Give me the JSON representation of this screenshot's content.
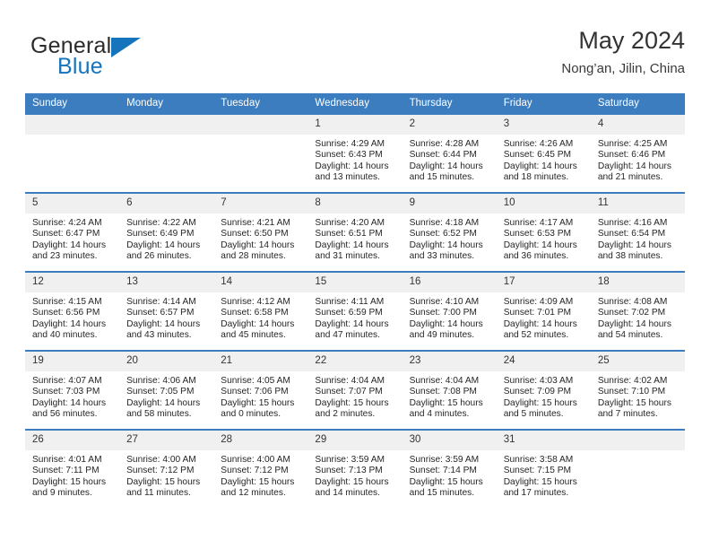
{
  "brand": {
    "line1": "General",
    "line2": "Blue",
    "flag_icon": "blue-triangle-flag",
    "accent_color": "#1574bb"
  },
  "header": {
    "title": "May 2024",
    "subtitle": "Nong’an, Jilin, China"
  },
  "theme": {
    "header_row_bg": "#3b7dbf",
    "header_row_text": "#ffffff",
    "daynum_bg": "#f0f0f0",
    "cell_border": "#3b7dbf"
  },
  "columns": [
    "Sunday",
    "Monday",
    "Tuesday",
    "Wednesday",
    "Thursday",
    "Friday",
    "Saturday"
  ],
  "labels": {
    "sunrise_prefix": "Sunrise:",
    "sunset_prefix": "Sunset:",
    "daylight_prefix": "Daylight:"
  },
  "weeks": [
    [
      {
        "day": "",
        "sunrise": "",
        "sunset": "",
        "daylight_a": "",
        "daylight_b": ""
      },
      {
        "day": "",
        "sunrise": "",
        "sunset": "",
        "daylight_a": "",
        "daylight_b": ""
      },
      {
        "day": "",
        "sunrise": "",
        "sunset": "",
        "daylight_a": "",
        "daylight_b": ""
      },
      {
        "day": "1",
        "sunrise": "Sunrise: 4:29 AM",
        "sunset": "Sunset: 6:43 PM",
        "daylight_a": "Daylight: 14 hours",
        "daylight_b": "and 13 minutes."
      },
      {
        "day": "2",
        "sunrise": "Sunrise: 4:28 AM",
        "sunset": "Sunset: 6:44 PM",
        "daylight_a": "Daylight: 14 hours",
        "daylight_b": "and 15 minutes."
      },
      {
        "day": "3",
        "sunrise": "Sunrise: 4:26 AM",
        "sunset": "Sunset: 6:45 PM",
        "daylight_a": "Daylight: 14 hours",
        "daylight_b": "and 18 minutes."
      },
      {
        "day": "4",
        "sunrise": "Sunrise: 4:25 AM",
        "sunset": "Sunset: 6:46 PM",
        "daylight_a": "Daylight: 14 hours",
        "daylight_b": "and 21 minutes."
      }
    ],
    [
      {
        "day": "5",
        "sunrise": "Sunrise: 4:24 AM",
        "sunset": "Sunset: 6:47 PM",
        "daylight_a": "Daylight: 14 hours",
        "daylight_b": "and 23 minutes."
      },
      {
        "day": "6",
        "sunrise": "Sunrise: 4:22 AM",
        "sunset": "Sunset: 6:49 PM",
        "daylight_a": "Daylight: 14 hours",
        "daylight_b": "and 26 minutes."
      },
      {
        "day": "7",
        "sunrise": "Sunrise: 4:21 AM",
        "sunset": "Sunset: 6:50 PM",
        "daylight_a": "Daylight: 14 hours",
        "daylight_b": "and 28 minutes."
      },
      {
        "day": "8",
        "sunrise": "Sunrise: 4:20 AM",
        "sunset": "Sunset: 6:51 PM",
        "daylight_a": "Daylight: 14 hours",
        "daylight_b": "and 31 minutes."
      },
      {
        "day": "9",
        "sunrise": "Sunrise: 4:18 AM",
        "sunset": "Sunset: 6:52 PM",
        "daylight_a": "Daylight: 14 hours",
        "daylight_b": "and 33 minutes."
      },
      {
        "day": "10",
        "sunrise": "Sunrise: 4:17 AM",
        "sunset": "Sunset: 6:53 PM",
        "daylight_a": "Daylight: 14 hours",
        "daylight_b": "and 36 minutes."
      },
      {
        "day": "11",
        "sunrise": "Sunrise: 4:16 AM",
        "sunset": "Sunset: 6:54 PM",
        "daylight_a": "Daylight: 14 hours",
        "daylight_b": "and 38 minutes."
      }
    ],
    [
      {
        "day": "12",
        "sunrise": "Sunrise: 4:15 AM",
        "sunset": "Sunset: 6:56 PM",
        "daylight_a": "Daylight: 14 hours",
        "daylight_b": "and 40 minutes."
      },
      {
        "day": "13",
        "sunrise": "Sunrise: 4:14 AM",
        "sunset": "Sunset: 6:57 PM",
        "daylight_a": "Daylight: 14 hours",
        "daylight_b": "and 43 minutes."
      },
      {
        "day": "14",
        "sunrise": "Sunrise: 4:12 AM",
        "sunset": "Sunset: 6:58 PM",
        "daylight_a": "Daylight: 14 hours",
        "daylight_b": "and 45 minutes."
      },
      {
        "day": "15",
        "sunrise": "Sunrise: 4:11 AM",
        "sunset": "Sunset: 6:59 PM",
        "daylight_a": "Daylight: 14 hours",
        "daylight_b": "and 47 minutes."
      },
      {
        "day": "16",
        "sunrise": "Sunrise: 4:10 AM",
        "sunset": "Sunset: 7:00 PM",
        "daylight_a": "Daylight: 14 hours",
        "daylight_b": "and 49 minutes."
      },
      {
        "day": "17",
        "sunrise": "Sunrise: 4:09 AM",
        "sunset": "Sunset: 7:01 PM",
        "daylight_a": "Daylight: 14 hours",
        "daylight_b": "and 52 minutes."
      },
      {
        "day": "18",
        "sunrise": "Sunrise: 4:08 AM",
        "sunset": "Sunset: 7:02 PM",
        "daylight_a": "Daylight: 14 hours",
        "daylight_b": "and 54 minutes."
      }
    ],
    [
      {
        "day": "19",
        "sunrise": "Sunrise: 4:07 AM",
        "sunset": "Sunset: 7:03 PM",
        "daylight_a": "Daylight: 14 hours",
        "daylight_b": "and 56 minutes."
      },
      {
        "day": "20",
        "sunrise": "Sunrise: 4:06 AM",
        "sunset": "Sunset: 7:05 PM",
        "daylight_a": "Daylight: 14 hours",
        "daylight_b": "and 58 minutes."
      },
      {
        "day": "21",
        "sunrise": "Sunrise: 4:05 AM",
        "sunset": "Sunset: 7:06 PM",
        "daylight_a": "Daylight: 15 hours",
        "daylight_b": "and 0 minutes."
      },
      {
        "day": "22",
        "sunrise": "Sunrise: 4:04 AM",
        "sunset": "Sunset: 7:07 PM",
        "daylight_a": "Daylight: 15 hours",
        "daylight_b": "and 2 minutes."
      },
      {
        "day": "23",
        "sunrise": "Sunrise: 4:04 AM",
        "sunset": "Sunset: 7:08 PM",
        "daylight_a": "Daylight: 15 hours",
        "daylight_b": "and 4 minutes."
      },
      {
        "day": "24",
        "sunrise": "Sunrise: 4:03 AM",
        "sunset": "Sunset: 7:09 PM",
        "daylight_a": "Daylight: 15 hours",
        "daylight_b": "and 5 minutes."
      },
      {
        "day": "25",
        "sunrise": "Sunrise: 4:02 AM",
        "sunset": "Sunset: 7:10 PM",
        "daylight_a": "Daylight: 15 hours",
        "daylight_b": "and 7 minutes."
      }
    ],
    [
      {
        "day": "26",
        "sunrise": "Sunrise: 4:01 AM",
        "sunset": "Sunset: 7:11 PM",
        "daylight_a": "Daylight: 15 hours",
        "daylight_b": "and 9 minutes."
      },
      {
        "day": "27",
        "sunrise": "Sunrise: 4:00 AM",
        "sunset": "Sunset: 7:12 PM",
        "daylight_a": "Daylight: 15 hours",
        "daylight_b": "and 11 minutes."
      },
      {
        "day": "28",
        "sunrise": "Sunrise: 4:00 AM",
        "sunset": "Sunset: 7:12 PM",
        "daylight_a": "Daylight: 15 hours",
        "daylight_b": "and 12 minutes."
      },
      {
        "day": "29",
        "sunrise": "Sunrise: 3:59 AM",
        "sunset": "Sunset: 7:13 PM",
        "daylight_a": "Daylight: 15 hours",
        "daylight_b": "and 14 minutes."
      },
      {
        "day": "30",
        "sunrise": "Sunrise: 3:59 AM",
        "sunset": "Sunset: 7:14 PM",
        "daylight_a": "Daylight: 15 hours",
        "daylight_b": "and 15 minutes."
      },
      {
        "day": "31",
        "sunrise": "Sunrise: 3:58 AM",
        "sunset": "Sunset: 7:15 PM",
        "daylight_a": "Daylight: 15 hours",
        "daylight_b": "and 17 minutes."
      },
      {
        "day": "",
        "sunrise": "",
        "sunset": "",
        "daylight_a": "",
        "daylight_b": ""
      }
    ]
  ]
}
